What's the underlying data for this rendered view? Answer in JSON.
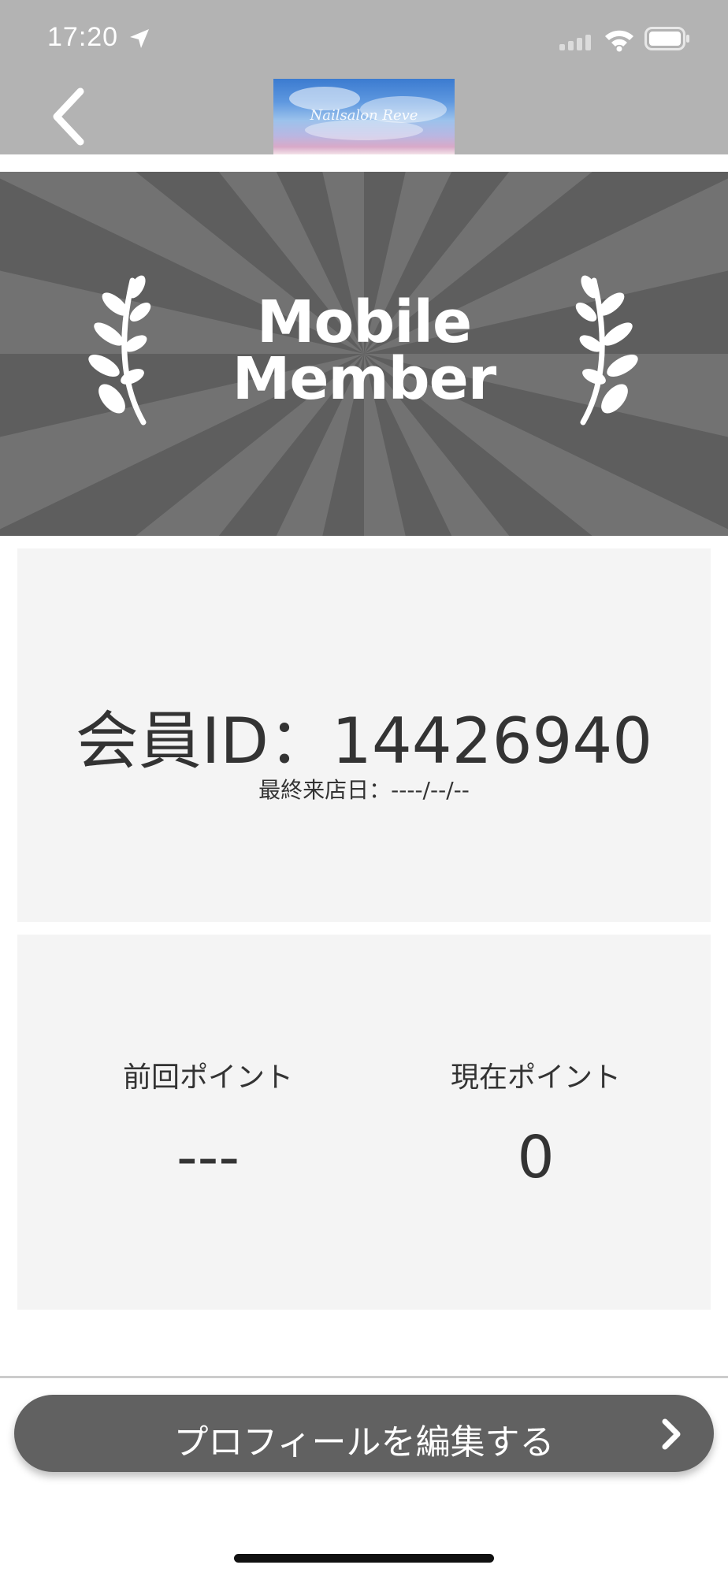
{
  "status_bar": {
    "time": "17:20",
    "icons": [
      "location-arrow-icon",
      "signal-icon",
      "wifi-icon",
      "battery-icon"
    ]
  },
  "nav": {
    "back_icon": "chevron-left-icon",
    "logo_text": "Nailsalon Reve"
  },
  "banner": {
    "title_line1": "Mobile",
    "title_line2": "Member",
    "icons": [
      "laurel-left-icon",
      "laurel-right-icon"
    ]
  },
  "member": {
    "id_text": "会員ID：14426940",
    "last_visit": "最終来店日：----/--/--"
  },
  "points": {
    "previous_label": "前回ポイント",
    "previous_value": "---",
    "current_label": "現在ポイント",
    "current_value": "0"
  },
  "actions": {
    "edit_profile_label": "プロフィールを編集する",
    "edit_profile_icon": "chevron-right-icon"
  },
  "colors": {
    "header_bg": "#b3b3b3",
    "banner_bg": "#5e5e5e",
    "card_bg": "#f4f4f4",
    "button_bg": "#616161"
  }
}
